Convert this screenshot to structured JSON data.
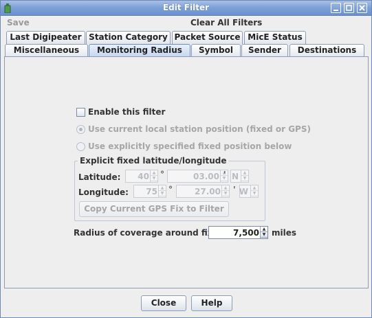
{
  "window": {
    "title": "Edit Filter"
  },
  "menu": {
    "save": "Save",
    "clear_all": "Clear All Filters"
  },
  "tabs_row1": [
    "Last Digipeater",
    "Station Category",
    "Packet Source",
    "MicE Status"
  ],
  "tabs_row2": [
    "Miscellaneous",
    "Monitoring Radius",
    "Symbol",
    "Sender",
    "Destinations"
  ],
  "selected_tab": "Monitoring Radius",
  "panel": {
    "enable_label": "Enable this filter",
    "radio_current": "Use current local station position (fixed or GPS)",
    "radio_explicit": "Use explicitly specified fixed position below",
    "group_title": "Explicit fixed latitude/longitude",
    "latitude_label": "Latitude:",
    "latitude_deg": "40",
    "latitude_min": "03.00",
    "latitude_dir": "N",
    "longitude_label": "Longitude:",
    "longitude_deg": "75",
    "longitude_min": "27.00",
    "longitude_dir": "W",
    "degree_symbol": "°",
    "minute_symbol": "'",
    "copy_gps_button": "Copy Current GPS Fix to Filter",
    "radius_label": "Radius of coverage around fix:",
    "radius_value": "7,500",
    "radius_unit": "miles"
  },
  "buttons": {
    "close": "Close",
    "help": "Help"
  }
}
